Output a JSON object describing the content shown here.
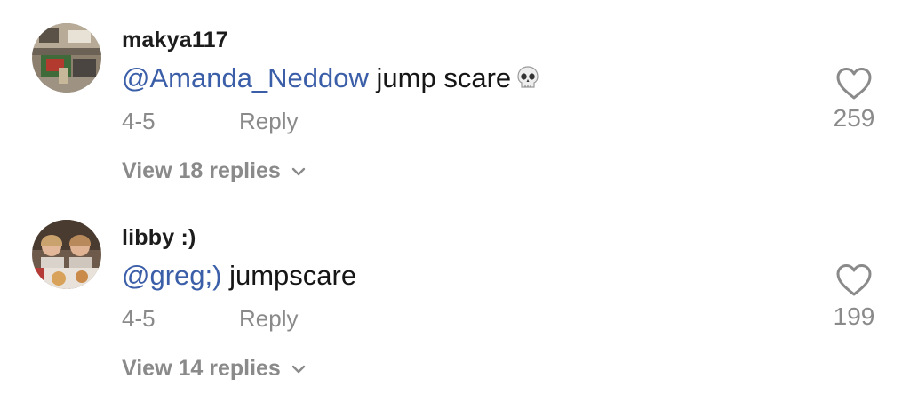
{
  "comments": [
    {
      "username": "makya117",
      "mention": "@Amanda_Neddow",
      "text": " jump scare",
      "emoji_icon": "skull-icon",
      "date": "4-5",
      "reply_label": "Reply",
      "likes": "259",
      "view_replies": "View 18 replies"
    },
    {
      "username": "libby :)",
      "mention": "@greg;)",
      "text": " jumpscare",
      "date": "4-5",
      "reply_label": "Reply",
      "likes": "199",
      "view_replies": "View 14 replies"
    }
  ],
  "colors": {
    "mention": "#3b5ea8",
    "secondary_text": "#8a8a8a",
    "primary_text": "#161616"
  },
  "icons": {
    "like": "heart-outline-icon",
    "expand": "chevron-down-icon"
  }
}
